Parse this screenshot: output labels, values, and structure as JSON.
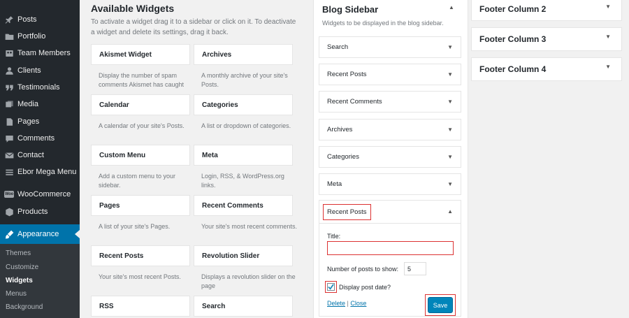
{
  "sidebar": {
    "items": [
      {
        "label": "Posts",
        "icon": "pin-icon"
      },
      {
        "label": "Portfolio",
        "icon": "folder-icon"
      },
      {
        "label": "Team Members",
        "icon": "group-icon"
      },
      {
        "label": "Clients",
        "icon": "users-icon"
      },
      {
        "label": "Testimonials",
        "icon": "quote-icon"
      },
      {
        "label": "Media",
        "icon": "media-icon"
      },
      {
        "label": "Pages",
        "icon": "page-icon"
      },
      {
        "label": "Comments",
        "icon": "comment-icon"
      },
      {
        "label": "Contact",
        "icon": "mail-icon"
      },
      {
        "label": "Ebor Mega Menu",
        "icon": "menu-icon"
      },
      {
        "label": "WooCommerce",
        "icon": "woocommerce-icon",
        "icon_text": "Woo"
      },
      {
        "label": "Products",
        "icon": "cube-icon"
      },
      {
        "label": "Appearance",
        "icon": "brush-icon",
        "current": true
      }
    ],
    "submenu": [
      {
        "label": "Themes"
      },
      {
        "label": "Customize"
      },
      {
        "label": "Widgets",
        "active": true
      },
      {
        "label": "Menus"
      },
      {
        "label": "Background"
      }
    ]
  },
  "available": {
    "title": "Available Widgets",
    "description": "To activate a widget drag it to a sidebar or click on it. To deactivate a widget and delete its settings, drag it back.",
    "widgets": [
      {
        "name": "Akismet Widget",
        "desc": "Display the number of spam comments Akismet has caught"
      },
      {
        "name": "Archives",
        "desc": "A monthly archive of your site's Posts."
      },
      {
        "name": "Calendar",
        "desc": "A calendar of your site's Posts."
      },
      {
        "name": "Categories",
        "desc": "A list or dropdown of categories."
      },
      {
        "name": "Custom Menu",
        "desc": "Add a custom menu to your sidebar."
      },
      {
        "name": "Meta",
        "desc": "Login, RSS, & WordPress.org links."
      },
      {
        "name": "Pages",
        "desc": "A list of your site's Pages."
      },
      {
        "name": "Recent Comments",
        "desc": "Your site's most recent comments."
      },
      {
        "name": "Recent Posts",
        "desc": "Your site's most recent Posts."
      },
      {
        "name": "Revolution Slider",
        "desc": "Displays a revolution slider on the page"
      },
      {
        "name": "RSS",
        "desc": ""
      },
      {
        "name": "Search",
        "desc": ""
      }
    ]
  },
  "blog_sidebar": {
    "title": "Blog Sidebar",
    "description": "Widgets to be displayed in the blog sidebar.",
    "widgets": [
      "Search",
      "Recent Posts",
      "Recent Comments",
      "Archives",
      "Categories",
      "Meta"
    ],
    "open_widget": {
      "name": "Recent Posts",
      "title_label": "Title:",
      "title_value": "",
      "number_label": "Number of posts to show:",
      "number_value": "5",
      "show_date_label": "Display post date?",
      "show_date_checked": true,
      "delete_label": "Delete",
      "separator": "|",
      "close_label": "Close",
      "save_label": "Save"
    }
  },
  "footer_columns": [
    "Footer Column 2",
    "Footer Column 3",
    "Footer Column 4"
  ],
  "colors": {
    "sidebar_bg": "#23282d",
    "accent": "#0073aa",
    "highlight_border": "#dc3232",
    "save_button": "#0085ba"
  }
}
